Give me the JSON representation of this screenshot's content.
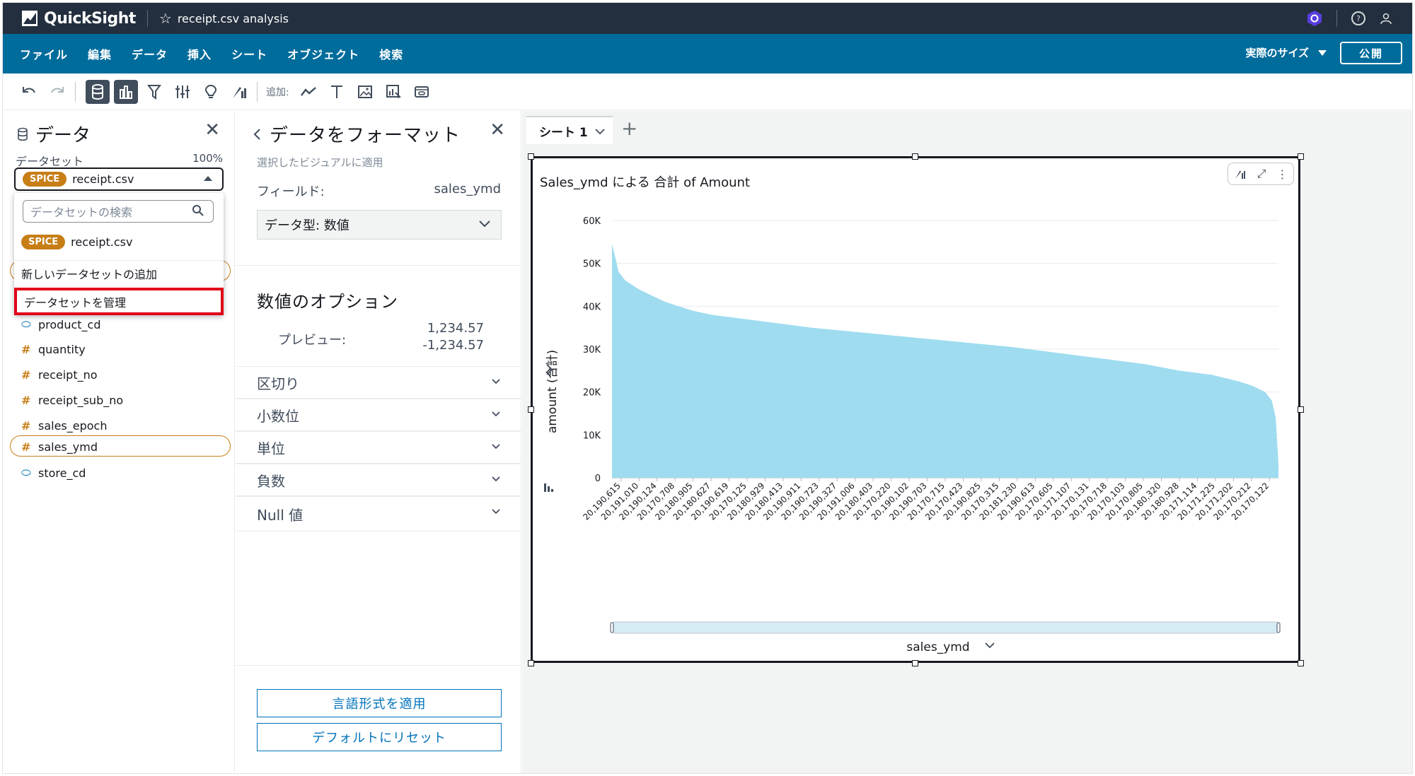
{
  "app": {
    "name": "QuickSight",
    "analysis_title": "receipt.csv analysis"
  },
  "menu": {
    "items": [
      "ファイル",
      "編集",
      "データ",
      "挿入",
      "シート",
      "オブジェクト",
      "検索"
    ],
    "size_label": "実際のサイズ",
    "publish": "公開"
  },
  "toolbar": {
    "add_label": "追加:"
  },
  "data_panel": {
    "title": "データ",
    "dataset_label": "データセット",
    "dataset_pct": "100%",
    "selected_dataset": {
      "badge": "SPICE",
      "name": "receipt.csv"
    },
    "dropdown": {
      "search_placeholder": "データセットの検索",
      "option": {
        "badge": "SPICE",
        "name": "receipt.csv"
      },
      "add_dataset": "新しいデータセットの追加",
      "manage_dataset": "データセットを管理"
    },
    "fields": [
      {
        "name": "product_cd",
        "type": "dimension"
      },
      {
        "name": "quantity",
        "type": "measure"
      },
      {
        "name": "receipt_no",
        "type": "measure"
      },
      {
        "name": "receipt_sub_no",
        "type": "measure"
      },
      {
        "name": "sales_epoch",
        "type": "measure"
      },
      {
        "name": "sales_ymd",
        "type": "measure",
        "selected": true
      },
      {
        "name": "store_cd",
        "type": "dimension"
      }
    ]
  },
  "format_panel": {
    "title": "データをフォーマット",
    "subtitle": "選択したビジュアルに適用",
    "field_label": "フィールド:",
    "field_value": "sales_ymd",
    "data_type": "データ型: 数値",
    "numeric_options": "数値のオプション",
    "preview_label": "プレビュー:",
    "preview_positive": "1,234.57",
    "preview_negative": "-1,234.57",
    "sections": [
      "区切り",
      "小数位",
      "単位",
      "負数",
      "Null 値"
    ],
    "apply_locale": "言語形式を適用",
    "reset_default": "デフォルトにリセット"
  },
  "canvas": {
    "sheet_tab": "シート 1"
  },
  "chart_data": {
    "type": "area",
    "title": "Sales_ymd による 合計 of Amount",
    "xlabel": "sales_ymd",
    "ylabel": "amount (合計)",
    "ylim": [
      0,
      60000
    ],
    "y_ticks": [
      "0",
      "10K",
      "20K",
      "30K",
      "40K",
      "50K",
      "60K"
    ],
    "x_tick_labels": [
      "20,190,615",
      "20,191,010",
      "20,190,124",
      "20,170,708",
      "20,180,905",
      "20,180,627",
      "20,190,619",
      "20,170,125",
      "20,180,929",
      "20,180,413",
      "20,190,911",
      "20,190,723",
      "20,190,327",
      "20,191,006",
      "20,180,403",
      "20,170,220",
      "20,190,102",
      "20,190,703",
      "20,170,715",
      "20,170,423",
      "20,190,825",
      "20,170,315",
      "20,181,230",
      "20,190,613",
      "20,170,605",
      "20,171,107",
      "20,170,131",
      "20,170,718",
      "20,170,103",
      "20,170,805",
      "20,180,320",
      "20,180,928",
      "20,171,114",
      "20,171,225",
      "20,171,202",
      "20,170,212",
      "20,170,122"
    ],
    "curve_profile": [
      [
        0,
        54500
      ],
      [
        0.004,
        52000
      ],
      [
        0.01,
        48000
      ],
      [
        0.02,
        46000
      ],
      [
        0.04,
        44000
      ],
      [
        0.06,
        42500
      ],
      [
        0.08,
        41000
      ],
      [
        0.1,
        40000
      ],
      [
        0.12,
        39000
      ],
      [
        0.15,
        38000
      ],
      [
        0.2,
        37000
      ],
      [
        0.3,
        35000
      ],
      [
        0.4,
        33500
      ],
      [
        0.5,
        32000
      ],
      [
        0.6,
        30500
      ],
      [
        0.7,
        28500
      ],
      [
        0.8,
        26500
      ],
      [
        0.85,
        25000
      ],
      [
        0.9,
        24000
      ],
      [
        0.94,
        22500
      ],
      [
        0.96,
        21500
      ],
      [
        0.98,
        20000
      ],
      [
        0.99,
        18000
      ],
      [
        0.996,
        14000
      ],
      [
        1,
        3000
      ]
    ],
    "color": "#9fdcf0",
    "grid": true
  }
}
